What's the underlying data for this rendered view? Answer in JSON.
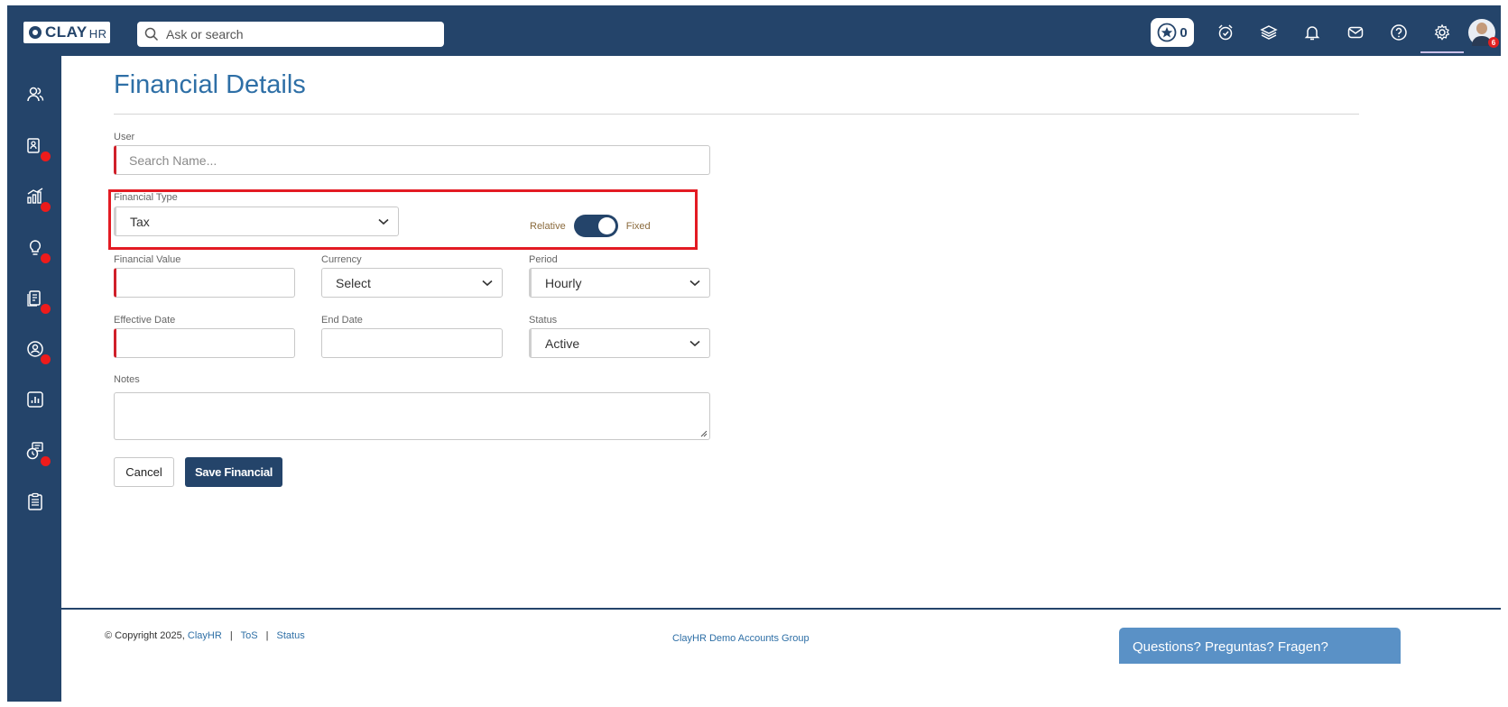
{
  "app": {
    "logo_text": "CLAY",
    "logo_suffix": "HR"
  },
  "search": {
    "placeholder": "Ask or search"
  },
  "topbar": {
    "star_count": "0",
    "avatar_badge": "6"
  },
  "page": {
    "title": "Financial Details"
  },
  "form": {
    "user_label": "User",
    "user_placeholder": "Search Name...",
    "financial_type_label": "Financial Type",
    "financial_type_value": "Tax",
    "toggle_left": "Relative",
    "toggle_right": "Fixed",
    "toggle_state": "Fixed",
    "financial_value_label": "Financial Value",
    "currency_label": "Currency",
    "currency_value": "Select",
    "period_label": "Period",
    "period_value": "Hourly",
    "effective_date_label": "Effective Date",
    "end_date_label": "End Date",
    "status_label": "Status",
    "status_value": "Active",
    "notes_label": "Notes",
    "cancel_label": "Cancel",
    "save_label": "Save Financial"
  },
  "footer": {
    "copyright": "© Copyright 2025,",
    "brand_link": "ClayHR",
    "tos": "ToS",
    "status": "Status",
    "separator": "|",
    "group": "ClayHR Demo Accounts Group",
    "help": "Questions? Preguntas? Fragen?"
  },
  "colors": {
    "brand": "#24446a",
    "accent": "#2e6fa6",
    "required": "#d0202a",
    "highlight": "#e31b23",
    "help": "#5a91c6"
  }
}
